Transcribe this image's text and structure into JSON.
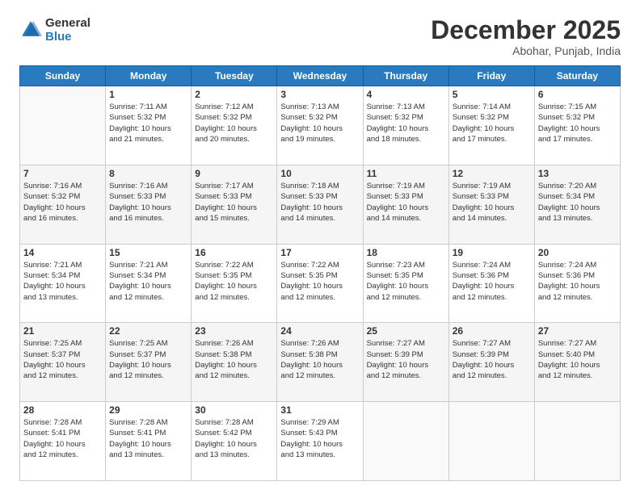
{
  "header": {
    "logo_line1": "General",
    "logo_line2": "Blue",
    "title": "December 2025",
    "location": "Abohar, Punjab, India"
  },
  "calendar": {
    "days_of_week": [
      "Sunday",
      "Monday",
      "Tuesday",
      "Wednesday",
      "Thursday",
      "Friday",
      "Saturday"
    ],
    "weeks": [
      [
        {
          "day": "",
          "info": ""
        },
        {
          "day": "1",
          "info": "Sunrise: 7:11 AM\nSunset: 5:32 PM\nDaylight: 10 hours\nand 21 minutes."
        },
        {
          "day": "2",
          "info": "Sunrise: 7:12 AM\nSunset: 5:32 PM\nDaylight: 10 hours\nand 20 minutes."
        },
        {
          "day": "3",
          "info": "Sunrise: 7:13 AM\nSunset: 5:32 PM\nDaylight: 10 hours\nand 19 minutes."
        },
        {
          "day": "4",
          "info": "Sunrise: 7:13 AM\nSunset: 5:32 PM\nDaylight: 10 hours\nand 18 minutes."
        },
        {
          "day": "5",
          "info": "Sunrise: 7:14 AM\nSunset: 5:32 PM\nDaylight: 10 hours\nand 17 minutes."
        },
        {
          "day": "6",
          "info": "Sunrise: 7:15 AM\nSunset: 5:32 PM\nDaylight: 10 hours\nand 17 minutes."
        }
      ],
      [
        {
          "day": "7",
          "info": "Sunrise: 7:16 AM\nSunset: 5:32 PM\nDaylight: 10 hours\nand 16 minutes."
        },
        {
          "day": "8",
          "info": "Sunrise: 7:16 AM\nSunset: 5:33 PM\nDaylight: 10 hours\nand 16 minutes."
        },
        {
          "day": "9",
          "info": "Sunrise: 7:17 AM\nSunset: 5:33 PM\nDaylight: 10 hours\nand 15 minutes."
        },
        {
          "day": "10",
          "info": "Sunrise: 7:18 AM\nSunset: 5:33 PM\nDaylight: 10 hours\nand 14 minutes."
        },
        {
          "day": "11",
          "info": "Sunrise: 7:19 AM\nSunset: 5:33 PM\nDaylight: 10 hours\nand 14 minutes."
        },
        {
          "day": "12",
          "info": "Sunrise: 7:19 AM\nSunset: 5:33 PM\nDaylight: 10 hours\nand 14 minutes."
        },
        {
          "day": "13",
          "info": "Sunrise: 7:20 AM\nSunset: 5:34 PM\nDaylight: 10 hours\nand 13 minutes."
        }
      ],
      [
        {
          "day": "14",
          "info": "Sunrise: 7:21 AM\nSunset: 5:34 PM\nDaylight: 10 hours\nand 13 minutes."
        },
        {
          "day": "15",
          "info": "Sunrise: 7:21 AM\nSunset: 5:34 PM\nDaylight: 10 hours\nand 12 minutes."
        },
        {
          "day": "16",
          "info": "Sunrise: 7:22 AM\nSunset: 5:35 PM\nDaylight: 10 hours\nand 12 minutes."
        },
        {
          "day": "17",
          "info": "Sunrise: 7:22 AM\nSunset: 5:35 PM\nDaylight: 10 hours\nand 12 minutes."
        },
        {
          "day": "18",
          "info": "Sunrise: 7:23 AM\nSunset: 5:35 PM\nDaylight: 10 hours\nand 12 minutes."
        },
        {
          "day": "19",
          "info": "Sunrise: 7:24 AM\nSunset: 5:36 PM\nDaylight: 10 hours\nand 12 minutes."
        },
        {
          "day": "20",
          "info": "Sunrise: 7:24 AM\nSunset: 5:36 PM\nDaylight: 10 hours\nand 12 minutes."
        }
      ],
      [
        {
          "day": "21",
          "info": "Sunrise: 7:25 AM\nSunset: 5:37 PM\nDaylight: 10 hours\nand 12 minutes."
        },
        {
          "day": "22",
          "info": "Sunrise: 7:25 AM\nSunset: 5:37 PM\nDaylight: 10 hours\nand 12 minutes."
        },
        {
          "day": "23",
          "info": "Sunrise: 7:26 AM\nSunset: 5:38 PM\nDaylight: 10 hours\nand 12 minutes."
        },
        {
          "day": "24",
          "info": "Sunrise: 7:26 AM\nSunset: 5:38 PM\nDaylight: 10 hours\nand 12 minutes."
        },
        {
          "day": "25",
          "info": "Sunrise: 7:27 AM\nSunset: 5:39 PM\nDaylight: 10 hours\nand 12 minutes."
        },
        {
          "day": "26",
          "info": "Sunrise: 7:27 AM\nSunset: 5:39 PM\nDaylight: 10 hours\nand 12 minutes."
        },
        {
          "day": "27",
          "info": "Sunrise: 7:27 AM\nSunset: 5:40 PM\nDaylight: 10 hours\nand 12 minutes."
        }
      ],
      [
        {
          "day": "28",
          "info": "Sunrise: 7:28 AM\nSunset: 5:41 PM\nDaylight: 10 hours\nand 12 minutes."
        },
        {
          "day": "29",
          "info": "Sunrise: 7:28 AM\nSunset: 5:41 PM\nDaylight: 10 hours\nand 13 minutes."
        },
        {
          "day": "30",
          "info": "Sunrise: 7:28 AM\nSunset: 5:42 PM\nDaylight: 10 hours\nand 13 minutes."
        },
        {
          "day": "31",
          "info": "Sunrise: 7:29 AM\nSunset: 5:43 PM\nDaylight: 10 hours\nand 13 minutes."
        },
        {
          "day": "",
          "info": ""
        },
        {
          "day": "",
          "info": ""
        },
        {
          "day": "",
          "info": ""
        }
      ]
    ]
  }
}
